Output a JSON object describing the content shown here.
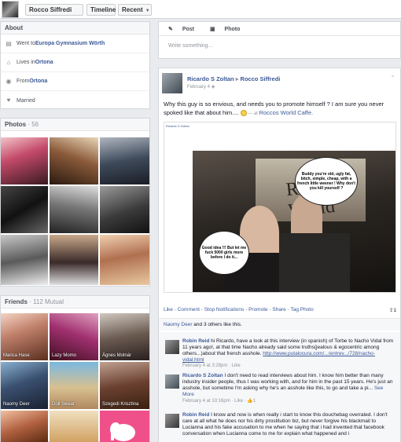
{
  "header": {
    "profile_name": "Rocco Siffredi",
    "timeline_label": "Timeline",
    "recent_label": "Recent"
  },
  "about": {
    "title": "About",
    "rows": [
      {
        "icon": "school-icon",
        "prefix": "Went to ",
        "value": "Europa Gymnasium Wörth"
      },
      {
        "icon": "home-icon",
        "prefix": "Lives in ",
        "value": "Ortona"
      },
      {
        "icon": "location-pin-icon",
        "prefix": "From ",
        "value": "Ortona"
      },
      {
        "icon": "heart-icon",
        "prefix": "",
        "value": "Married"
      }
    ]
  },
  "photos": {
    "title": "Photos",
    "count": "· 56"
  },
  "friends": {
    "title": "Friends",
    "count": "· 112 Mutual",
    "items": [
      "Marica Hase",
      "Lazy Momo",
      "Ágnes Molnár",
      "Naomy Deer",
      "Doll Sweat",
      "Szegedi Krisztina"
    ]
  },
  "composer": {
    "post_tab": "Post",
    "photo_tab": "Photo",
    "placeholder": "Write something..."
  },
  "post": {
    "author": "Ricardo S Zoltan",
    "arrow": "▸",
    "target": "Rocco Siffredi",
    "date": "February 4",
    "text": "Why this guy is so envious, and needs you to promote himself ? I am sure you never spoked like that about him....",
    "at_prefix": " — at ",
    "place": "Roccos World Caffe.",
    "bubble1": "Buddy you're old, ugly fat, bitch, simple, cheap, with a french little weener ! Why don't you kill yourself ?",
    "bubble2": "Good idea !!! But let me fuck 5000 girls more before I do it...",
    "sign_text": "Rocco's World",
    "embedded_author": "Ricardo S Zoltan",
    "actions": [
      "Like",
      "Comment",
      "Stop Notifications",
      "Promote",
      "Share",
      "Tag Photo"
    ],
    "share_count": "1",
    "likes_name": "Naomy Deer",
    "likes_rest": " and 3 others like this."
  },
  "comments": [
    {
      "author": "Robin Reid",
      "text": "hi Ricardo, have a look at this interview (in spanish) of Torbe to Nacho Vidal from 11 years ago!, at that time Nacho already said some truths(jealous & egocentric among others...)about that french asshole.",
      "link": "http://www.putalocura.com/.../entrev.../728/nacho-vidal.html",
      "meta": "February 4 at 3:28pm · Like"
    },
    {
      "author": "Ricardo S Zoltan",
      "text": "I don't need to read interviews about him. I know him better than many industry insider people, thus I was working with, and for him in the past 15 years. He's just an asshole, but sometime I'm asking why he's an asshole like this, to go and take a pi...",
      "see_more": "See More",
      "meta": "February 4 at 10:16pm · Like · ",
      "likes": "1"
    },
    {
      "author": "Robin Reid",
      "text": "I know and now is when really i start to know this douchebag overrated. I don't care at all what he does nor his dirty prostitution biz, but never forgive his blackmail to Lucianna and his fake accusation to me when he saying that i had invented that facebook conversation when Lucianna come to me for explain what happened and i",
      "meta": ""
    }
  ],
  "colors": {
    "link": "#3b5998",
    "bg": "#e9ebee",
    "border": "#d3d6db"
  }
}
